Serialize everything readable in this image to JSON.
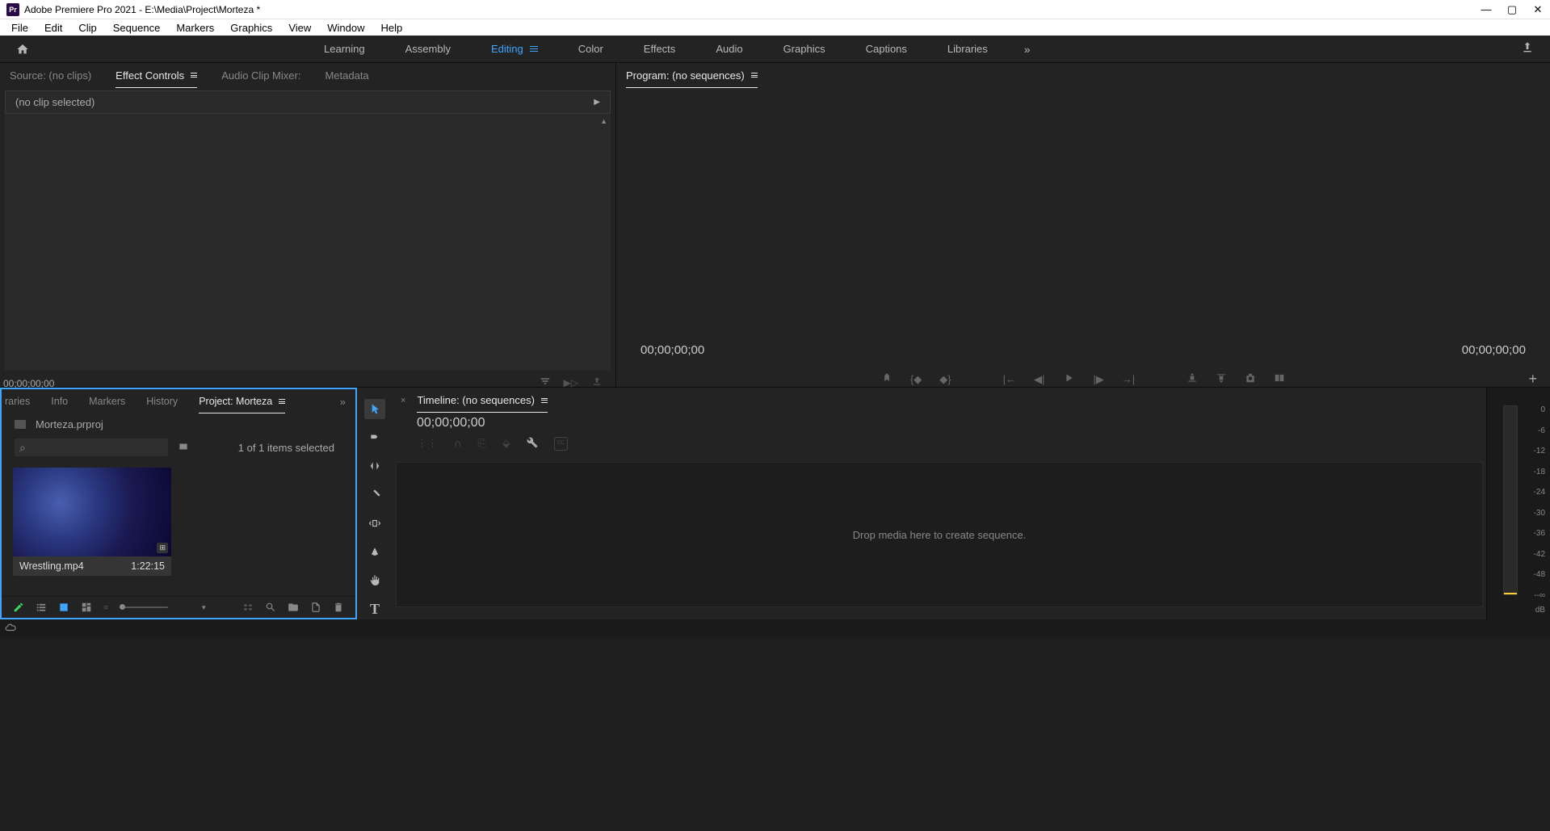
{
  "titlebar": {
    "icon_text": "Pr",
    "title": "Adobe Premiere Pro 2021 - E:\\Media\\Project\\Morteza *"
  },
  "menubar": [
    "File",
    "Edit",
    "Clip",
    "Sequence",
    "Markers",
    "Graphics",
    "View",
    "Window",
    "Help"
  ],
  "workspaces": {
    "items": [
      "Learning",
      "Assembly",
      "Editing",
      "Color",
      "Effects",
      "Audio",
      "Graphics",
      "Captions",
      "Libraries"
    ],
    "active": "Editing"
  },
  "source_panel": {
    "tabs": [
      "Source: (no clips)",
      "Effect Controls",
      "Audio Clip Mixer:",
      "Metadata"
    ],
    "active_tab": "Effect Controls",
    "clip_status": "(no clip selected)",
    "timecode": "00;00;00;00"
  },
  "program_panel": {
    "title": "Program: (no sequences)",
    "timecode_left": "00;00;00;00",
    "timecode_right": "00;00;00;00"
  },
  "project_panel": {
    "tabs": [
      "raries",
      "Info",
      "Markers",
      "History",
      "Project: Morteza"
    ],
    "active_tab": "Project: Morteza",
    "project_file": "Morteza.prproj",
    "items_count": "1 of 1 items selected",
    "search_placeholder": "",
    "clip": {
      "name": "Wrestling.mp4",
      "duration": "1:22:15"
    }
  },
  "timeline_panel": {
    "title": "Timeline: (no sequences)",
    "timecode": "00;00;00;00",
    "drop_text": "Drop media here to create sequence."
  },
  "audio_meter": {
    "labels": [
      "0",
      "-6",
      "-12",
      "-18",
      "-24",
      "-30",
      "-36",
      "-42",
      "-48",
      "--∞"
    ],
    "unit": "dB"
  }
}
